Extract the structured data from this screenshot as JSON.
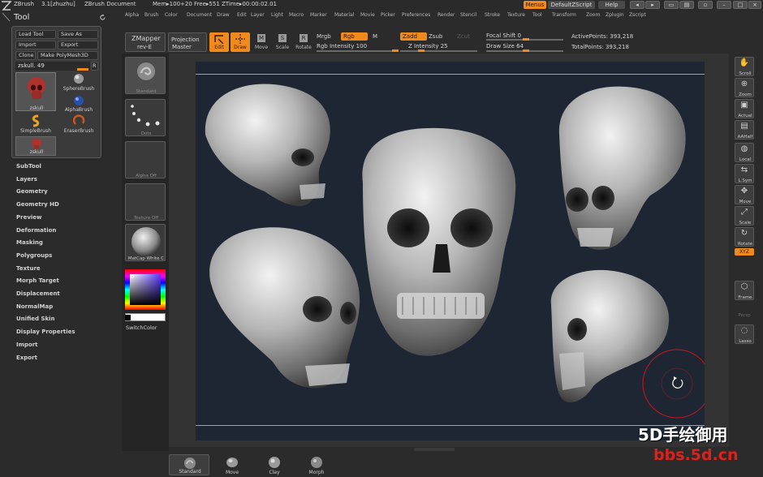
{
  "title_bar": {
    "app": "ZBrush",
    "version": "3.1[zhuzhu]",
    "document": "ZBrush Document",
    "mem": "Mem▸100+20 Free▸551 ZTime▸00:00:02.01",
    "menus_button": "Menus",
    "script_button": "DefaultZScript",
    "help_button": "Help"
  },
  "menu_items": [
    "Alpha",
    "Brush",
    "Color",
    "Document",
    "Draw",
    "Edit",
    "Layer",
    "Light",
    "Macro",
    "Marker",
    "Material",
    "Movie",
    "Picker",
    "Preferences",
    "Render",
    "Stencil",
    "Stroke",
    "Texture",
    "Tool",
    "Transform",
    "Zoom",
    "Zplugin",
    "Zscript"
  ],
  "tool_palette": {
    "title": "Tool",
    "buttons": {
      "load": "Load Tool",
      "save": "Save As",
      "import": "Import",
      "export": "Export",
      "clone": "Clone",
      "polymesh": "Make PolyMesh3D"
    },
    "current_tool": "zskull. 49",
    "r_button": "R",
    "tiles": [
      {
        "label": "zskull"
      },
      {
        "label": "SphereBrush"
      },
      {
        "label": "AlphaBrush"
      },
      {
        "label": "SimpleBrush"
      },
      {
        "label": "EraserBrush"
      },
      {
        "label": "zskull"
      }
    ]
  },
  "subpalettes": [
    "SubTool",
    "Layers",
    "Geometry",
    "Geometry HD",
    "Preview",
    "Deformation",
    "Masking",
    "Polygroups",
    "Texture",
    "Morph Target",
    "Displacement",
    "NormalMap",
    "Unified Skin",
    "Display Properties",
    "Import",
    "Export"
  ],
  "left_shelf": {
    "brush": "Standard",
    "stroke": "Dots",
    "alpha": "Alpha Off",
    "texture": "Texture Off",
    "material": "MatCap White C",
    "switch_color": "SwitchColor"
  },
  "toolbar": {
    "zmapper": "ZMapper",
    "zmapper_sub": "rev-E",
    "projection": "Projection",
    "projection_sub": "Master",
    "edit": "Edit",
    "draw": "Draw",
    "move": "Move",
    "scale": "Scale",
    "rotate": "Rotate",
    "mrgb": "Mrgb",
    "rgb": "Rgb",
    "m": "M",
    "rgb_intensity": "Rgb Intensity 100",
    "zadd": "Zadd",
    "zsub": "Zsub",
    "zcut": "Zcut",
    "z_intensity": "Z Intensity 25",
    "focal_shift": "Focal Shift 0",
    "draw_size": "Draw Size 64",
    "active_points": "ActivePoints: 393,218",
    "total_points": "TotalPoints: 393,218"
  },
  "right_rail": [
    "Scroll",
    "Zoom",
    "Actual",
    "AAHalf",
    "Local",
    "L.Sym",
    "Move",
    "Scale",
    "Rotate",
    "Frame",
    "Lasso"
  ],
  "right_rail_xyz": "XYZ",
  "right_rail_persp": "Persp",
  "bottom_shelf": [
    "Standard",
    "Move",
    "Clay",
    "Morph"
  ],
  "watermark": {
    "line1": "5D手绘御用",
    "line2": "bbs.5d.cn"
  },
  "colors": {
    "accent": "#f08a1c",
    "canvas": "#1f2633",
    "ui_bg": "#2b2b2b",
    "watermark_red": "#e0201a"
  }
}
